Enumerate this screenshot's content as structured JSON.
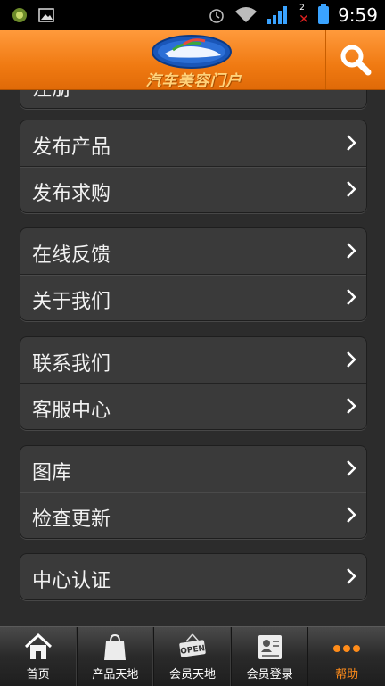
{
  "status_bar": {
    "time": "9:59",
    "notification_count": "2",
    "icons": [
      "android-app-icon",
      "image-icon",
      "alarm-icon",
      "wifi-icon",
      "signal-icon",
      "no-data-icon",
      "battery-icon"
    ]
  },
  "header": {
    "logo_text": "汽车美容门户",
    "search_icon": "search-icon",
    "accent_color": "#f07a12"
  },
  "menu": {
    "partial_item": "注册",
    "groups": [
      {
        "items": [
          {
            "label": "发布产品"
          },
          {
            "label": "发布求购"
          }
        ]
      },
      {
        "items": [
          {
            "label": "在线反馈"
          },
          {
            "label": "关于我们"
          }
        ]
      },
      {
        "items": [
          {
            "label": "联系我们"
          },
          {
            "label": "客服中心"
          }
        ]
      },
      {
        "items": [
          {
            "label": "图库"
          },
          {
            "label": "检查更新"
          }
        ]
      },
      {
        "items": [
          {
            "label": "中心认证"
          }
        ]
      }
    ]
  },
  "bottom_nav": {
    "items": [
      {
        "label": "首页",
        "icon": "home-icon"
      },
      {
        "label": "产品天地",
        "icon": "shopping-bag-icon"
      },
      {
        "label": "会员天地",
        "icon": "open-sign-icon"
      },
      {
        "label": "会员登录",
        "icon": "id-card-icon"
      },
      {
        "label": "帮助",
        "icon": "more-dots-icon",
        "active": true
      }
    ],
    "active_color": "#ff8c1a"
  }
}
